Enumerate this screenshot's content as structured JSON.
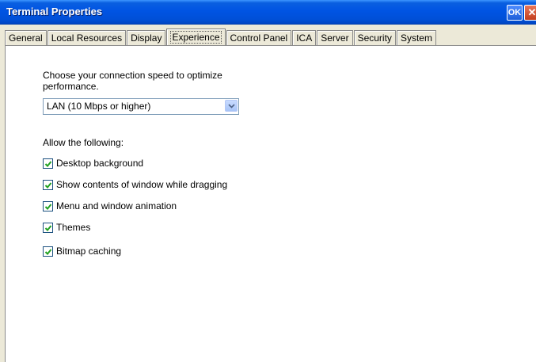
{
  "window": {
    "title": "Terminal Properties",
    "ok_label": "OK",
    "close_label": "✕"
  },
  "tabs": [
    {
      "label": "General"
    },
    {
      "label": "Local Resources"
    },
    {
      "label": "Display"
    },
    {
      "label": "Experience"
    },
    {
      "label": "Control Panel"
    },
    {
      "label": "ICA"
    },
    {
      "label": "Server"
    },
    {
      "label": "Security"
    },
    {
      "label": "System"
    }
  ],
  "active_tab": "Experience",
  "experience": {
    "prompt": "Choose your connection speed to optimize performance.",
    "speed_selected": "LAN (10 Mbps or higher)",
    "allow_label": "Allow the following:",
    "options": [
      {
        "label": "Desktop background",
        "checked": true
      },
      {
        "label": "Show contents of window while dragging",
        "checked": true
      },
      {
        "label": "Menu and window animation",
        "checked": true
      },
      {
        "label": "Themes",
        "checked": true
      },
      {
        "label": "Bitmap caching",
        "checked": true
      }
    ]
  },
  "colors": {
    "titlebar": "#0054e3",
    "check": "#21a121",
    "dialog_bg": "#ece9d8"
  }
}
